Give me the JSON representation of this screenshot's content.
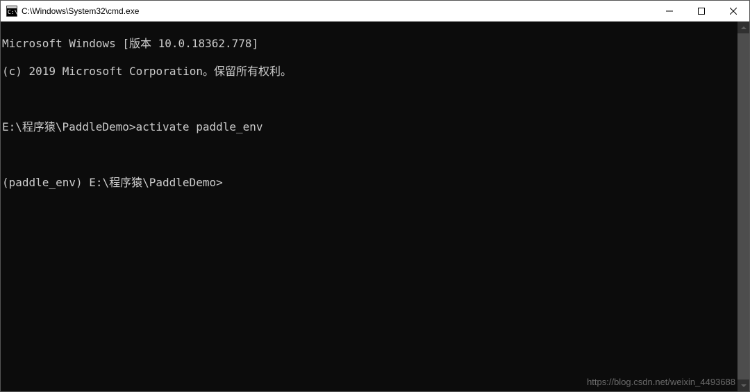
{
  "window": {
    "title": "C:\\Windows\\System32\\cmd.exe"
  },
  "terminal": {
    "lines": {
      "l0": "Microsoft Windows [版本 10.0.18362.778]",
      "l1": "(c) 2019 Microsoft Corporation。保留所有权利。",
      "l2": "",
      "l3": "E:\\程序猿\\PaddleDemo>activate paddle_env",
      "l4": "",
      "l5": "(paddle_env) E:\\程序猿\\PaddleDemo>"
    }
  },
  "watermark": "https://blog.csdn.net/weixin_4493688"
}
